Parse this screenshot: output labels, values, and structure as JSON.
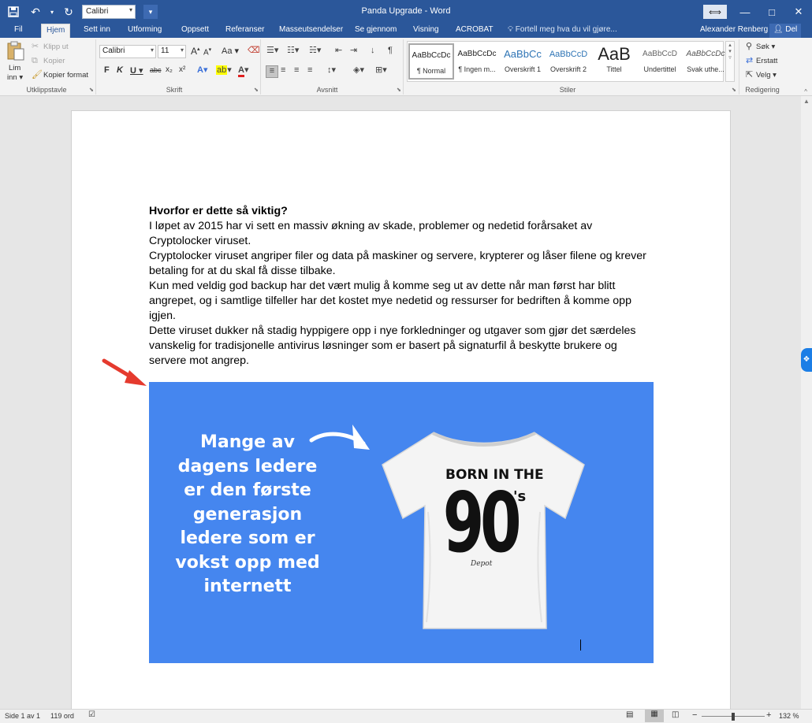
{
  "titlebar": {
    "title": "Panda Upgrade - Word",
    "qat_font": "Calibri",
    "icons": [
      "save-icon",
      "undo-icon",
      "redo-icon",
      "customize-qat-icon"
    ]
  },
  "window": {
    "minimize": "—",
    "maximize": "□",
    "close": "✕",
    "ribbon_display": "⟺"
  },
  "tabs": [
    {
      "label": "Fil"
    },
    {
      "label": "Hjem"
    },
    {
      "label": "Sett inn"
    },
    {
      "label": "Utforming"
    },
    {
      "label": "Oppsett"
    },
    {
      "label": "Referanser"
    },
    {
      "label": "Masseutsendelser"
    },
    {
      "label": "Se gjennom"
    },
    {
      "label": "Visning"
    },
    {
      "label": "ACROBAT"
    }
  ],
  "tellme": "Fortell meg hva du vil gjøre...",
  "user": {
    "name": "Alexander Renberg",
    "share": "Del"
  },
  "clipboard": {
    "paste": "Lim",
    "paste2": "inn",
    "cut": "Klipp ut",
    "copy": "Kopier",
    "format_painter": "Kopier format",
    "group": "Utklippstavle"
  },
  "font": {
    "name": "Calibri",
    "size": "11",
    "grow": "A",
    "shrink": "A",
    "case": "Aa",
    "bold": "F",
    "italic": "K",
    "underline": "U",
    "strike": "abc",
    "sub": "x₂",
    "sup": "x²",
    "group": "Skrift"
  },
  "paragraph": {
    "group": "Avsnitt",
    "pilcrow": "¶"
  },
  "styles": {
    "group": "Stiler",
    "items": [
      {
        "sample": "AaBbCcDc",
        "name": "¶ Normal"
      },
      {
        "sample": "AaBbCcDc",
        "name": "¶ Ingen m..."
      },
      {
        "sample": "AaBbCc",
        "name": "Overskrift 1"
      },
      {
        "sample": "AaBbCcD",
        "name": "Overskrift 2"
      },
      {
        "sample": "AaB",
        "name": "Tittel"
      },
      {
        "sample": "AaBbCcD",
        "name": "Undertittel"
      },
      {
        "sample": "AaBbCcDc",
        "name": "Svak uthe..."
      }
    ]
  },
  "editing": {
    "find": "Søk",
    "replace": "Erstatt",
    "select": "Velg",
    "group": "Redigering"
  },
  "document": {
    "heading": "Hvorfor er dette så viktig?",
    "lines": [
      "I løpet av 2015 har vi sett en massiv økning av skade, problemer og nedetid forårsaket av",
      "Cryptolocker viruset.",
      "Cryptolocker viruset angriper filer og data på maskiner og servere, krypterer og låser filene og krever",
      "betaling for at du skal få disse tilbake.",
      "Kun med veldig god backup har det vært mulig å komme seg ut av dette når man først har blitt",
      "angrepet, og i samtlige tilfeller har det kostet mye nedetid og ressurser for bedriften å komme opp",
      "igjen.",
      "Dette viruset dukker nå stadig hyppigere opp i nye forkledninger og utgaver som gjør det særdeles",
      "vanskelig for tradisjonelle antivirus løsninger som er basert på signaturfil å beskytte brukere og",
      "servere mot angrep."
    ],
    "image": {
      "text_lines": [
        "Mange av",
        "dagens ledere",
        "er den første",
        "generasjon",
        "ledere som er",
        "vokst opp med",
        "internett"
      ],
      "shirt_line1": "BORN IN THE",
      "shirt_big": "90",
      "shirt_suffix": "'s",
      "shirt_brand": "Depot",
      "background": "#4586ef"
    }
  },
  "status": {
    "page": "Side 1 av 1",
    "words": "119 ord",
    "zoom": "132 %",
    "zoom_minus": "−",
    "zoom_plus": "+"
  }
}
